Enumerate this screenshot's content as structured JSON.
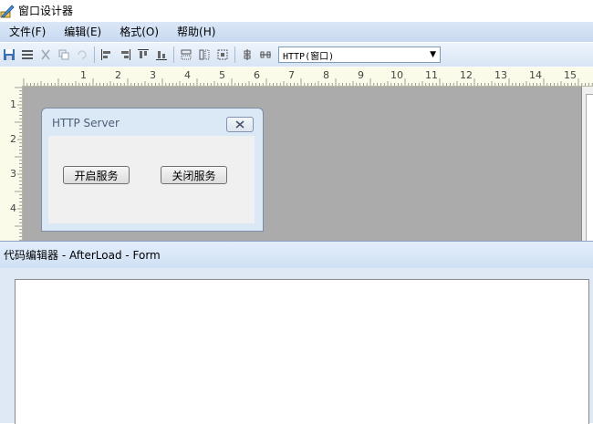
{
  "window": {
    "title": "窗口设计器"
  },
  "menu": {
    "items": [
      {
        "label": "文件(F)"
      },
      {
        "label": "编辑(E)"
      },
      {
        "label": "格式(O)"
      },
      {
        "label": "帮助(H)"
      }
    ]
  },
  "toolbar": {
    "object_selector": {
      "value": "HTTP(窗口)"
    }
  },
  "ruler": {
    "horizontal": [
      "1",
      "2",
      "3",
      "4",
      "5",
      "6",
      "7",
      "8",
      "9",
      "10",
      "11",
      "12",
      "13",
      "14",
      "15"
    ],
    "vertical": [
      "1",
      "2",
      "3",
      "4"
    ]
  },
  "form": {
    "caption": "HTTP Server",
    "start_button": "开启服务",
    "stop_button": "关闭服务"
  },
  "editor": {
    "title": "代码编辑器 - AfterLoad - Form"
  }
}
